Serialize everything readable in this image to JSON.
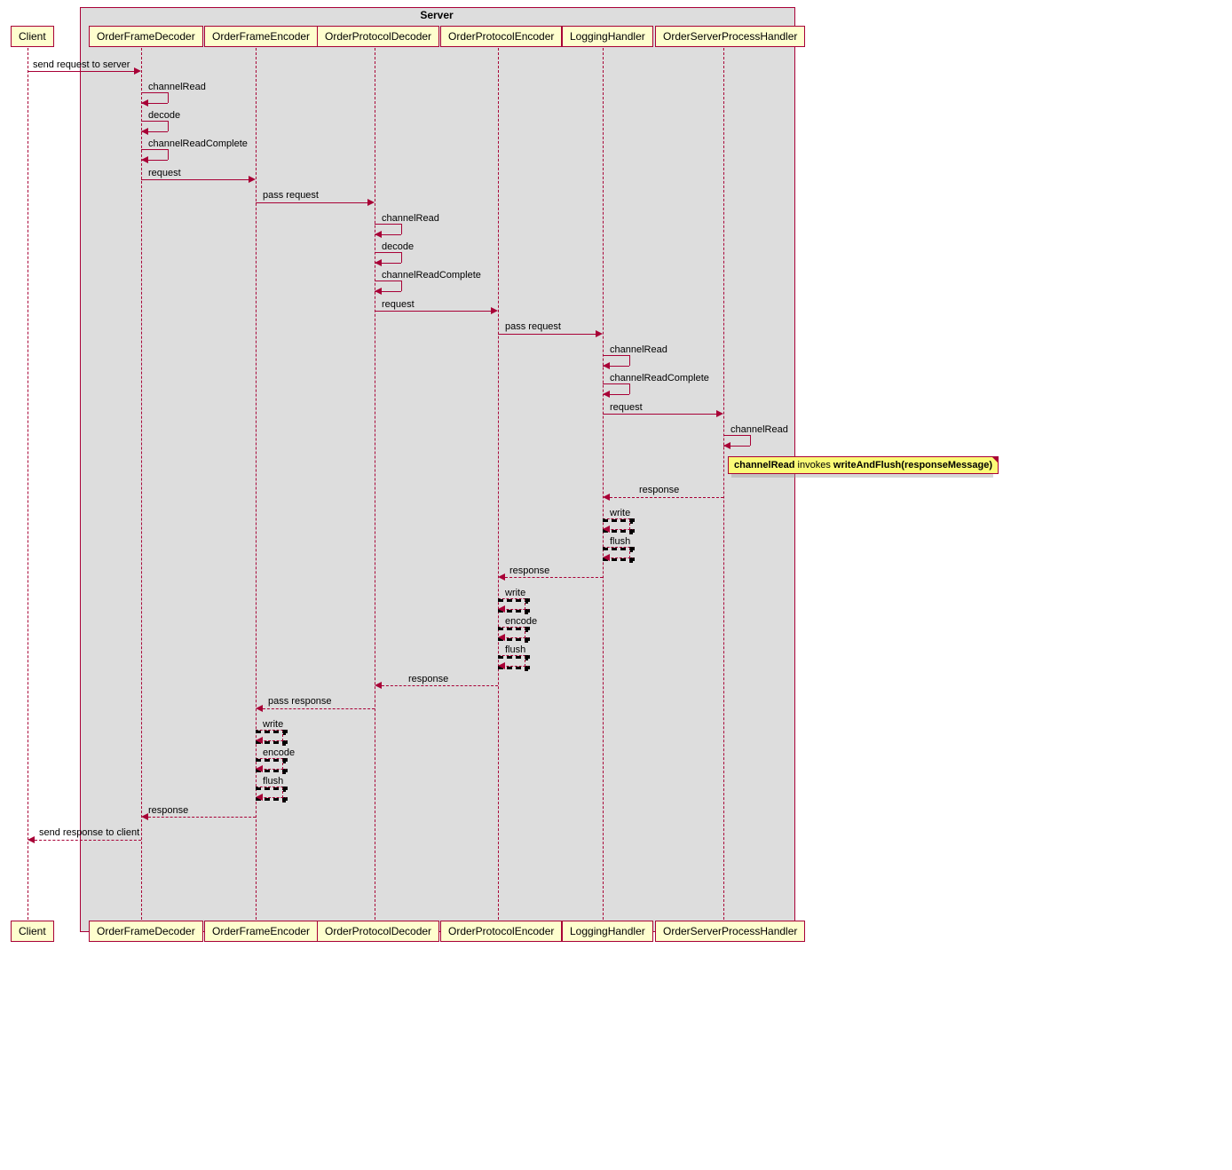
{
  "box_title": "Server",
  "participants": {
    "client": "Client",
    "ofd": "OrderFrameDecoder",
    "ofe": "OrderFrameEncoder",
    "opd": "OrderProtocolDecoder",
    "ope": "OrderProtocolEncoder",
    "log": "LoggingHandler",
    "osph": "OrderServerProcessHandler"
  },
  "messages": {
    "m1": "send request to server",
    "m2": "channelRead",
    "m3": "decode",
    "m4": "channelReadComplete",
    "m5": "request",
    "m6": "pass request",
    "m7": "channelRead",
    "m8": "decode",
    "m9": "channelReadComplete",
    "m10": "request",
    "m11": "pass request",
    "m12": "channelRead",
    "m13": "channelReadComplete",
    "m14": "request",
    "m15": "channelRead",
    "m16": "response",
    "m17": "write",
    "m18": "flush",
    "m19": "response",
    "m20": "write",
    "m21": "encode",
    "m22": "flush",
    "m23": "response",
    "m24": "pass response",
    "m25": "write",
    "m26": "encode",
    "m27": "flush",
    "m28": "response",
    "m29": "send response to client"
  },
  "note": {
    "prefix": "channelRead",
    "middle": " invokes ",
    "suffix": "writeAndFlush(responseMessage)"
  },
  "chart_data": {
    "type": "sequence_diagram",
    "box": "Server",
    "participants": [
      {
        "id": "Client",
        "in_box": false
      },
      {
        "id": "OrderFrameDecoder",
        "in_box": true
      },
      {
        "id": "OrderFrameEncoder",
        "in_box": true
      },
      {
        "id": "OrderProtocolDecoder",
        "in_box": true
      },
      {
        "id": "OrderProtocolEncoder",
        "in_box": true
      },
      {
        "id": "LoggingHandler",
        "in_box": true
      },
      {
        "id": "OrderServerProcessHandler",
        "in_box": true
      }
    ],
    "events": [
      {
        "from": "Client",
        "to": "OrderFrameDecoder",
        "label": "send request to server",
        "style": "solid"
      },
      {
        "from": "OrderFrameDecoder",
        "to": "OrderFrameDecoder",
        "label": "channelRead",
        "style": "solid"
      },
      {
        "from": "OrderFrameDecoder",
        "to": "OrderFrameDecoder",
        "label": "decode",
        "style": "solid"
      },
      {
        "from": "OrderFrameDecoder",
        "to": "OrderFrameDecoder",
        "label": "channelReadComplete",
        "style": "solid"
      },
      {
        "from": "OrderFrameDecoder",
        "to": "OrderFrameEncoder",
        "label": "request",
        "style": "solid"
      },
      {
        "from": "OrderFrameEncoder",
        "to": "OrderProtocolDecoder",
        "label": "pass request",
        "style": "solid"
      },
      {
        "from": "OrderProtocolDecoder",
        "to": "OrderProtocolDecoder",
        "label": "channelRead",
        "style": "solid"
      },
      {
        "from": "OrderProtocolDecoder",
        "to": "OrderProtocolDecoder",
        "label": "decode",
        "style": "solid"
      },
      {
        "from": "OrderProtocolDecoder",
        "to": "OrderProtocolDecoder",
        "label": "channelReadComplete",
        "style": "solid"
      },
      {
        "from": "OrderProtocolDecoder",
        "to": "OrderProtocolEncoder",
        "label": "request",
        "style": "solid"
      },
      {
        "from": "OrderProtocolEncoder",
        "to": "LoggingHandler",
        "label": "pass request",
        "style": "solid"
      },
      {
        "from": "LoggingHandler",
        "to": "LoggingHandler",
        "label": "channelRead",
        "style": "solid"
      },
      {
        "from": "LoggingHandler",
        "to": "LoggingHandler",
        "label": "channelReadComplete",
        "style": "solid"
      },
      {
        "from": "LoggingHandler",
        "to": "OrderServerProcessHandler",
        "label": "request",
        "style": "solid"
      },
      {
        "from": "OrderServerProcessHandler",
        "to": "OrderServerProcessHandler",
        "label": "channelRead",
        "style": "solid"
      },
      {
        "type": "note",
        "on": "OrderServerProcessHandler",
        "text": "channelRead invokes writeAndFlush(responseMessage)"
      },
      {
        "from": "OrderServerProcessHandler",
        "to": "LoggingHandler",
        "label": "response",
        "style": "dashed"
      },
      {
        "from": "LoggingHandler",
        "to": "LoggingHandler",
        "label": "write",
        "style": "dashed"
      },
      {
        "from": "LoggingHandler",
        "to": "LoggingHandler",
        "label": "flush",
        "style": "dashed"
      },
      {
        "from": "LoggingHandler",
        "to": "OrderProtocolEncoder",
        "label": "response",
        "style": "dashed"
      },
      {
        "from": "OrderProtocolEncoder",
        "to": "OrderProtocolEncoder",
        "label": "write",
        "style": "dashed"
      },
      {
        "from": "OrderProtocolEncoder",
        "to": "OrderProtocolEncoder",
        "label": "encode",
        "style": "dashed"
      },
      {
        "from": "OrderProtocolEncoder",
        "to": "OrderProtocolEncoder",
        "label": "flush",
        "style": "dashed"
      },
      {
        "from": "OrderProtocolEncoder",
        "to": "OrderProtocolDecoder",
        "label": "response",
        "style": "dashed"
      },
      {
        "from": "OrderProtocolDecoder",
        "to": "OrderFrameEncoder",
        "label": "pass response",
        "style": "dashed"
      },
      {
        "from": "OrderFrameEncoder",
        "to": "OrderFrameEncoder",
        "label": "write",
        "style": "dashed"
      },
      {
        "from": "OrderFrameEncoder",
        "to": "OrderFrameEncoder",
        "label": "encode",
        "style": "dashed"
      },
      {
        "from": "OrderFrameEncoder",
        "to": "OrderFrameEncoder",
        "label": "flush",
        "style": "dashed"
      },
      {
        "from": "OrderFrameEncoder",
        "to": "OrderFrameDecoder",
        "label": "response",
        "style": "dashed"
      },
      {
        "from": "OrderFrameDecoder",
        "to": "Client",
        "label": "send response to client",
        "style": "dashed"
      }
    ]
  }
}
